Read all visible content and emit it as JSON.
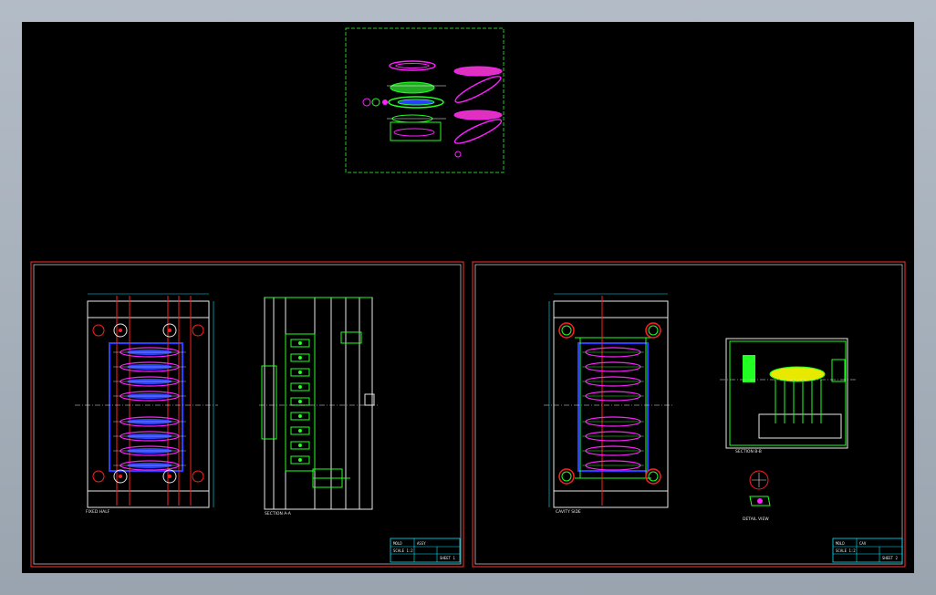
{
  "drawing": {
    "background": "#000000",
    "colors": {
      "magenta": "#ff20ff",
      "green": "#22ff22",
      "blue": "#2840ff",
      "red": "#ff2020",
      "cyan": "#00e8ff",
      "white": "#e8e8e8",
      "yellow": "#e8e800",
      "frame_red": "#ff3030",
      "dashed_green": "#22c822"
    },
    "sheets": [
      {
        "name": "top-parts-overview"
      },
      {
        "name": "left-sheet-mold-assembly"
      },
      {
        "name": "right-sheet-cavity-layout"
      }
    ],
    "view_labels": {
      "left_plan": "FIXED HALF",
      "left_section": "SECTION A-A",
      "right_plan": "CAVITY SIDE",
      "right_section": "SECTION B-B",
      "right_detail": "DETAIL VIEW"
    },
    "title_blocks": [
      {
        "id": "left",
        "lines": [
          "MOLD",
          "ASSY",
          "SCALE 1:2",
          "SHEET 1"
        ]
      },
      {
        "id": "right",
        "lines": [
          "MOLD",
          "CAV",
          "SCALE 1:2",
          "SHEET 2"
        ]
      }
    ]
  }
}
